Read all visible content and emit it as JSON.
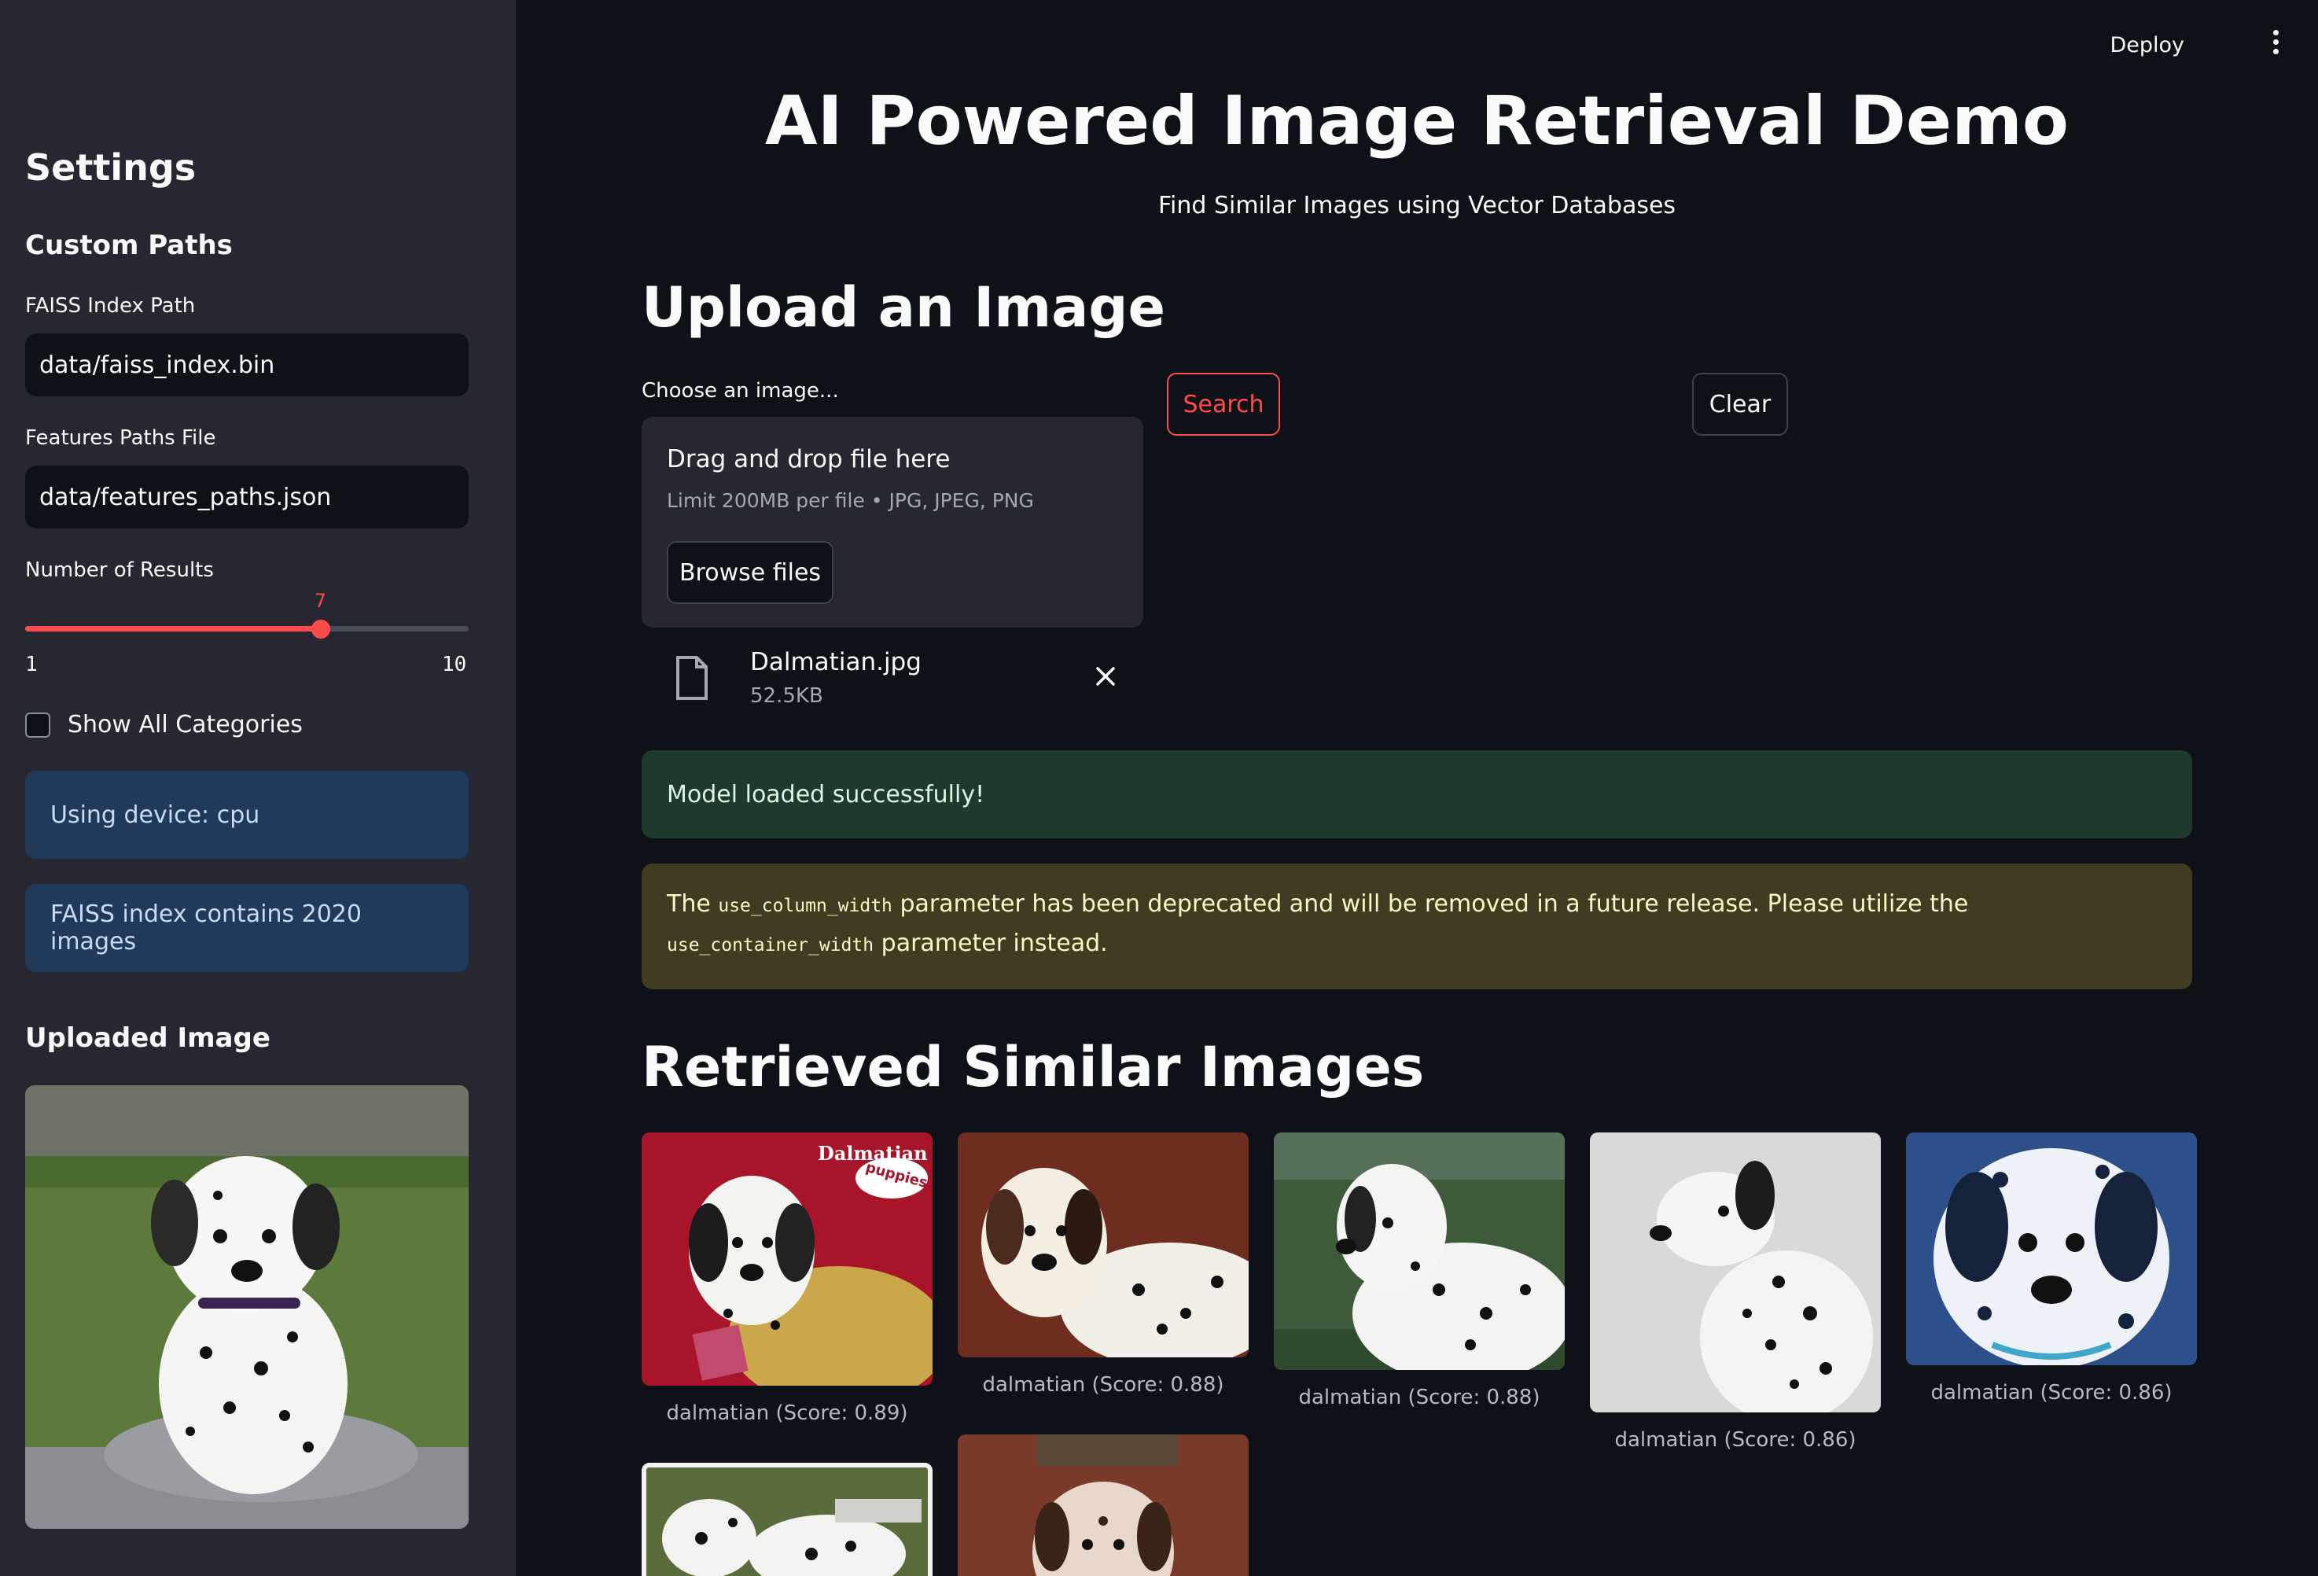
{
  "sidebar": {
    "title": "Settings",
    "custom_paths_header": "Custom Paths",
    "faiss_label": "FAISS Index Path",
    "faiss_value": "data/faiss_index.bin",
    "features_label": "Features Paths File",
    "features_value": "data/features_paths.json",
    "num_results_label": "Number of Results",
    "num_results": {
      "value": "7",
      "min": "1",
      "max": "10",
      "fraction": 0.667
    },
    "show_all_label": "Show All Categories",
    "show_all_checked": false,
    "device_info": "Using device: cpu",
    "index_info": "FAISS index contains 2020 images",
    "uploaded_header": "Uploaded Image"
  },
  "topbar": {
    "deploy": "Deploy",
    "menu_icon": "kebab-menu-icon"
  },
  "header": {
    "title": "AI Powered Image Retrieval Demo",
    "subtitle": "Find Similar Images using Vector Databases"
  },
  "upload": {
    "header": "Upload an Image",
    "label": "Choose an image...",
    "drop_title": "Drag and drop file here",
    "drop_limit": "Limit 200MB per file • JPG, JPEG, PNG",
    "browse_label": "Browse files",
    "file_name": "Dalmatian.jpg",
    "file_size": "52.5KB"
  },
  "actions": {
    "search_label": "Search",
    "clear_label": "Clear"
  },
  "alerts": {
    "success": "Model loaded successfully!",
    "warning_pre": "The ",
    "warning_code1": "use_column_width",
    "warning_mid": " parameter has been deprecated and will be removed in a future release. Please utilize the ",
    "warning_code2": "use_container_width",
    "warning_post": " parameter instead."
  },
  "results": {
    "header": "Retrieved Similar Images",
    "items": [
      {
        "caption": "dalmatian (Score: 0.89)",
        "badge_title": "Dalmatian",
        "badge_sub": "puppies"
      },
      {
        "caption": "dalmatian (Score: 0.88)"
      },
      {
        "caption": "dalmatian (Score: 0.88)"
      },
      {
        "caption": "dalmatian (Score: 0.86)"
      },
      {
        "caption": "dalmatian (Score: 0.86)"
      },
      {
        "caption": ""
      },
      {
        "caption": ""
      }
    ]
  },
  "colors": {
    "accent": "#ff4b4b",
    "sidebar_bg": "#262730",
    "main_bg": "#0e1117",
    "info_bg": "#1f3a5a",
    "success_bg": "#1e3a2a",
    "warning_bg": "#3f3c22"
  }
}
